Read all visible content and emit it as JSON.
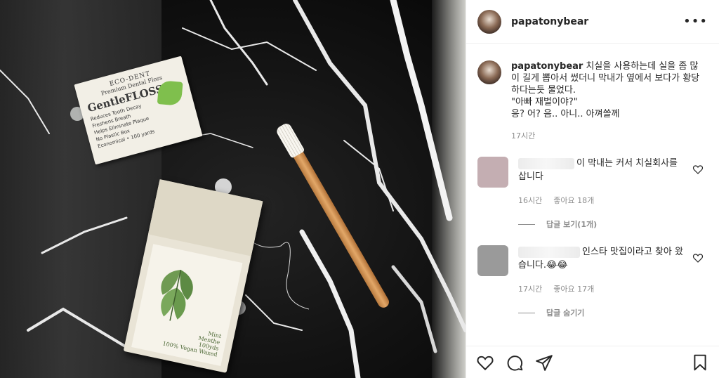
{
  "post": {
    "username": "papatonybear",
    "more_icon": "more-horizontal-icon"
  },
  "photo": {
    "floss_card": {
      "brand": "ECO-DENT",
      "subtitle": "Premium Dental Floss",
      "name": "GentleFLOSS",
      "bullets": [
        "Reduces Tooth Decay",
        "Freshens Breath",
        "Helps Eliminate Plaque",
        "No Plastic Box",
        "Economical • 100 yards"
      ]
    },
    "floss_box": {
      "flavor": "Mint",
      "flavor_alt": "Menthe",
      "tagline": "100% Vegan Waxed",
      "yards": "100yds"
    }
  },
  "caption": {
    "username": "papatonybear",
    "text_lines": [
      "치실을 사용하는데 실을 좀 많이 길게 뽑아서 썼더니 막내가 옆에서 보다가 황당하다는듯 물었다.",
      "\"아빠 재벌이야?\"",
      "응? 어? 음.. 아니.. 아껴쓸께"
    ],
    "time": "17시간"
  },
  "comments": [
    {
      "text": "이 막내는 커서 치실회사를 삽니다",
      "time": "16시간",
      "likes": "좋아요 18개",
      "replies": "답글 보기(1개)",
      "avatar_color": "#c4aeb2"
    },
    {
      "text": "인스타 맛집이라고 찾아 왔습니다.😂😂",
      "time": "17시간",
      "likes": "좋아요 17개",
      "replies": "답글 숨기기",
      "avatar_color": "#9a9a9a"
    }
  ],
  "actions": {
    "icons": [
      "heart-icon",
      "comment-icon",
      "share-icon",
      "bookmark-icon"
    ]
  }
}
